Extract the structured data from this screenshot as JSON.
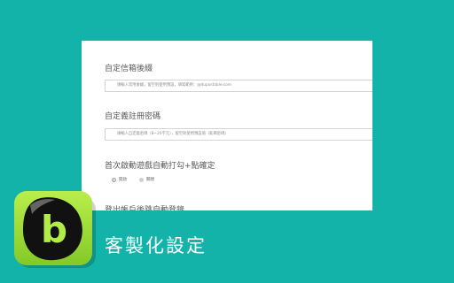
{
  "settings": {
    "suffix_title": "自定信箱後綴",
    "suffix_placeholder": "請輸入常用後綴，留空則使用預設，填寫範例：@dupostable.com",
    "password_title": "自定義註冊密碼",
    "password_placeholder": "請輸入自定義密碼（8~20字元），留空則使用預設值（亂碼密碼）",
    "auto_check_title": "首次啟動遊戲自動打勾+點確定",
    "radio_on_label": "開啟",
    "radio_off_label": "關閉",
    "auto_login_title": "登出帳戶後跳自動登錄"
  },
  "app": {
    "icon_letter": "b",
    "caption": "客製化設定"
  },
  "colors": {
    "background": "#13b3a9",
    "icon_green": "#a4e23c",
    "panel": "#ffffff"
  }
}
